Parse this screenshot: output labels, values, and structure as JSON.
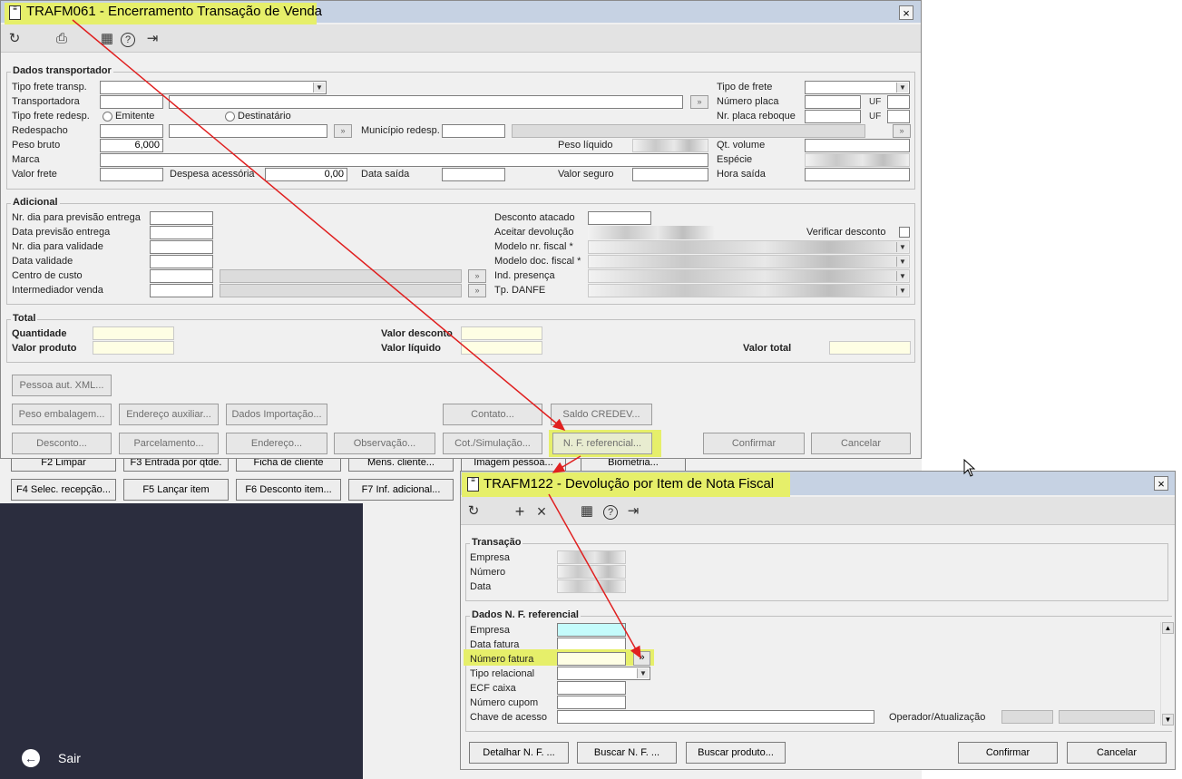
{
  "win1": {
    "title": "TRAFM061 - Encerramento Transação de Venda",
    "close": "×",
    "toolbar": {
      "refresh": "↻",
      "print": "⎙",
      "calendar": "▦",
      "help": "?",
      "exit": "⇥"
    },
    "dados_transportador": {
      "legend": "Dados transportador",
      "tipo_frete_transp": "Tipo frete transp.",
      "transportadora": "Transportadora",
      "tipo_frete_redesp": "Tipo frete redesp.",
      "emitente": "Emitente",
      "destinatario": "Destinatário",
      "redespacho": "Redespacho",
      "municipio_redesp": "Município redesp.",
      "peso_bruto": "Peso bruto",
      "peso_bruto_value": "6,000",
      "peso_liquido": "Peso líquido",
      "marca": "Marca",
      "valor_frete": "Valor frete",
      "despesa_acessoria": "Despesa acessória",
      "despesa_acessoria_value": "0,00",
      "data_saida": "Data saída",
      "valor_seguro": "Valor seguro",
      "tipo_de_frete": "Tipo de frete",
      "numero_placa": "Número placa",
      "nr_placa_reboque": "Nr. placa reboque",
      "qt_volume": "Qt. volume",
      "especie": "Espécie",
      "hora_saida": "Hora saída",
      "uf": "UF"
    },
    "adicional": {
      "legend": "Adicional",
      "nr_dia_previsao": "Nr. dia para previsão entrega",
      "data_previsao": "Data previsão entrega",
      "nr_dia_validade": "Nr. dia para validade",
      "data_validade": "Data validade",
      "centro_custo": "Centro de custo",
      "intermediador": "Intermediador venda",
      "desconto_atacado": "Desconto atacado",
      "aceitar_devolucao": "Aceitar devolução",
      "verificar_desconto": "Verificar desconto",
      "modelo_nr_fiscal": "Modelo nr. fiscal *",
      "modelo_doc_fiscal": "Modelo doc. fiscal *",
      "ind_presenca": "Ind. presença",
      "tp_danfe": "Tp. DANFE"
    },
    "total": {
      "legend": "Total",
      "quantidade": "Quantidade",
      "valor_produto": "Valor produto",
      "valor_desconto": "Valor desconto",
      "valor_liquido": "Valor líquido",
      "valor_total": "Valor total"
    },
    "buttons": {
      "pessoa_aut_xml": "Pessoa aut. XML...",
      "peso_embalagem": "Peso embalagem...",
      "endereco_auxiliar": "Endereço auxiliar...",
      "dados_importacao": "Dados Importação...",
      "contato": "Contato...",
      "saldo_credev": "Saldo CREDEV...",
      "desconto": "Desconto...",
      "parcelamento": "Parcelamento...",
      "endereco": "Endereço...",
      "observacao": "Observação...",
      "cot_simulacao": "Cot./Simulação...",
      "nf_referencial": "N. F. referencial...",
      "confirmar": "Confirmar",
      "cancelar": "Cancelar"
    }
  },
  "background": {
    "row1": [
      "F2 Limpar",
      "F3 Entrada por qtde.",
      "Ficha de cliente",
      "Mens. cliente...",
      "Imagem pessoa...",
      "Biometria..."
    ],
    "row2": [
      "F4 Selec. recepção...",
      "F5 Lançar item",
      "F6 Desconto item...",
      "F7 Inf. adicional..."
    ],
    "sair": "Sair"
  },
  "win2": {
    "title": "TRAFM122 - Devolução por Item de Nota Fiscal",
    "close": "×",
    "toolbar": {
      "refresh": "↻",
      "add": "+",
      "delete": "×",
      "calendar": "▦",
      "help": "?",
      "exit": "⇥"
    },
    "transacao": {
      "legend": "Transação",
      "empresa": "Empresa",
      "numero": "Número",
      "data": "Data"
    },
    "dados_nf": {
      "legend": "Dados N. F. referencial",
      "empresa": "Empresa",
      "data_fatura": "Data fatura",
      "numero_fatura": "Número fatura",
      "tipo_relacional": "Tipo relacional",
      "ecf_caixa": "ECF caixa",
      "numero_cupom": "Número cupom",
      "chave_acesso": "Chave de acesso",
      "operador": "Operador/Atualização",
      "lookup": "»"
    },
    "buttons": {
      "detalhar": "Detalhar N. F. ...",
      "buscar_nf": "Buscar N. F. ...",
      "buscar_produto": "Buscar produto...",
      "confirmar": "Confirmar",
      "cancelar": "Cancelar"
    }
  },
  "colors": {
    "annotation_arrow": "#e02020",
    "highlight": "#e6ef6a",
    "titlebar": "#c6d2e3",
    "dark_panel": "#2b2d3e"
  }
}
